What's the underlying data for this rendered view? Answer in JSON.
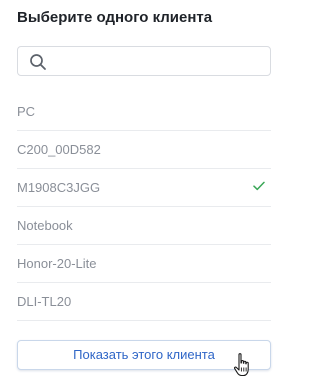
{
  "dialog": {
    "title": "Выберите одного клиента"
  },
  "search": {
    "value": "",
    "placeholder": ""
  },
  "clients": [
    {
      "label": "PC",
      "selected": false
    },
    {
      "label": "C200_00D582",
      "selected": false
    },
    {
      "label": "M1908C3JGG",
      "selected": true
    },
    {
      "label": "Notebook",
      "selected": false
    },
    {
      "label": "Honor-20-Lite",
      "selected": false
    },
    {
      "label": "DLI-TL20",
      "selected": false
    }
  ],
  "actions": {
    "show_client_label": "Показать этого клиента"
  },
  "colors": {
    "accent": "#2f66c7",
    "check": "#3aa757",
    "item_text": "#8a8f98",
    "divider": "#e9ebee"
  },
  "icons": {
    "search": "search-icon",
    "selected": "check-icon",
    "pointer": "hand-pointer-cursor-icon"
  }
}
